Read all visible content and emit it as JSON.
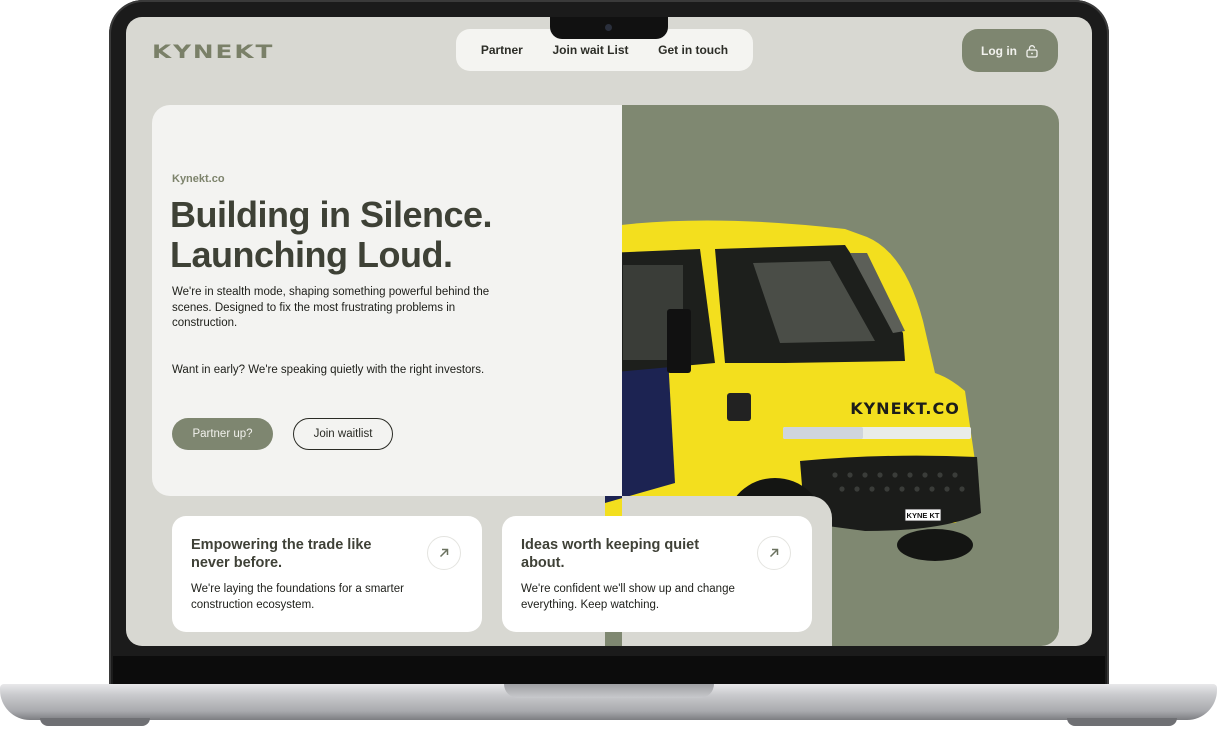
{
  "brand": {
    "logo": "KYNEKT",
    "domain_eyebrow": "Kynekt.co"
  },
  "nav": {
    "items": [
      "Partner",
      "Join wait List",
      "Get in touch"
    ]
  },
  "login": {
    "label": "Log in",
    "icon": "lock-icon"
  },
  "hero": {
    "headline_line1": "Building in Silence.",
    "headline_line2": "Launching Loud.",
    "description": "We're in stealth mode, shaping something powerful behind the scenes. Designed to fix the most frustrating problems in construction.",
    "investors": "Want in early? We're speaking quietly with the right investors.",
    "primary_button": "Partner up?",
    "secondary_button": "Join waitlist"
  },
  "van": {
    "side_text": "KYNEKT.CO",
    "plate": "KYNE KT"
  },
  "cards": [
    {
      "title": "Empowering the trade like never before.",
      "body": "We're laying the foundations for a smarter construction ecosystem.",
      "icon": "arrow-up-right-icon"
    },
    {
      "title": "Ideas worth keeping quiet about.",
      "body": "We're confident we'll show up and change everything. Keep watching.",
      "icon": "arrow-up-right-icon"
    }
  ],
  "colors": {
    "accent": "#7e8670",
    "panel": "#7f8871",
    "background": "#d8d8d2",
    "van_yellow": "#f3df1e"
  }
}
